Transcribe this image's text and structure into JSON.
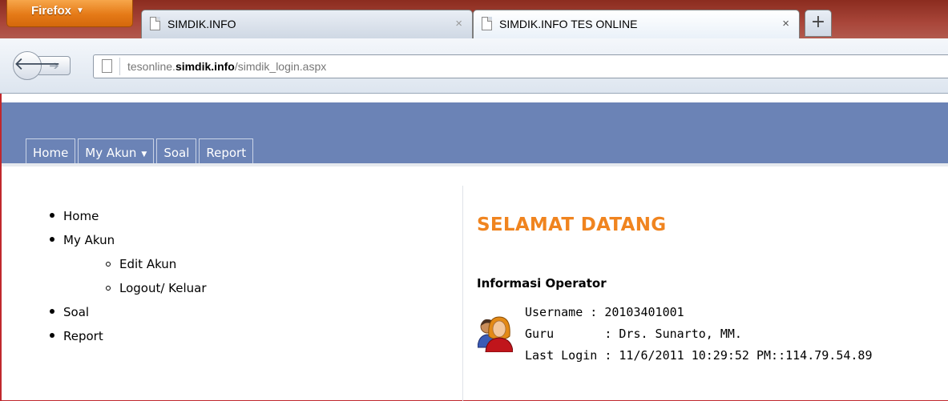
{
  "browser": {
    "app_button": "Firefox",
    "tabs": [
      {
        "title": "SIMDIK.INFO",
        "active": false
      },
      {
        "title": "SIMDIK.INFO TES ONLINE",
        "active": true
      }
    ],
    "new_tab": "+",
    "close_glyph": "×",
    "url": {
      "prefix": "tesonline.",
      "domain": "simdik.info",
      "path": "/simdik_login.aspx"
    }
  },
  "menu": [
    {
      "label": "Home"
    },
    {
      "label": "My Akun",
      "has_dropdown": true
    },
    {
      "label": "Soal"
    },
    {
      "label": "Report"
    }
  ],
  "sidebar": {
    "items": [
      {
        "label": "Home"
      },
      {
        "label": "My Akun"
      },
      {
        "label": "Edit Akun",
        "child": true
      },
      {
        "label": "Logout/ Keluar",
        "child": true
      },
      {
        "label": "Soal"
      },
      {
        "label": "Report"
      }
    ]
  },
  "main": {
    "welcome": "SELAMAT DATANG",
    "info_title": "Informasi Operator",
    "rows": [
      {
        "label": "Username",
        "sep": " : ",
        "value": "20103401001"
      },
      {
        "label": "Guru      ",
        "sep": " : ",
        "value": "Drs. Sunarto, MM."
      },
      {
        "label": "Last Login",
        "sep": " : ",
        "value": "11/6/2011 10:29:52 PM::114.79.54.89"
      }
    ]
  },
  "colors": {
    "header": "#6b83b6",
    "welcome": "#f0841f",
    "page_border": "#c0282d"
  }
}
